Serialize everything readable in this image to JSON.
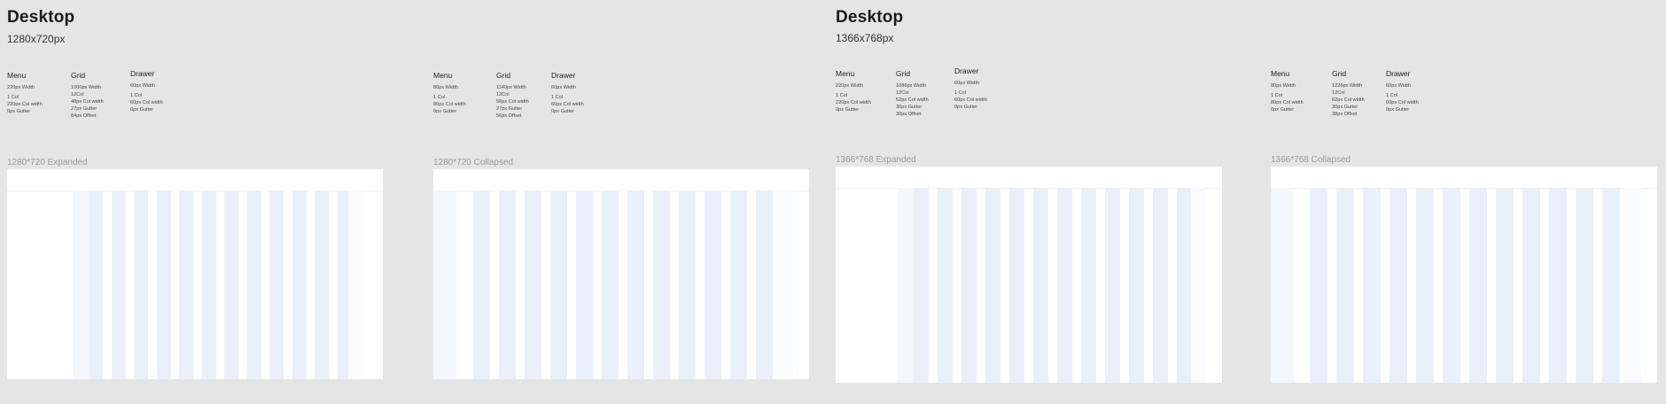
{
  "sections": [
    {
      "title": "Desktop",
      "subtitle": "1280x720px",
      "blocks": [
        {
          "columns": [
            {
              "heading": "Menu",
              "lines": [
                "220px Width",
                "",
                "1 Col",
                "220px Col width",
                "0px Gutter"
              ]
            },
            {
              "heading": "Grid",
              "lines": [
                "1000px Width",
                "12Col",
                "48px Col width",
                "27px Gutter",
                "84px Offset"
              ]
            },
            {
              "heading": "Drawer",
              "lines": [
                "60px Width",
                "",
                "1 Col",
                "60px Col width",
                "0px Gutter"
              ]
            }
          ]
        },
        {
          "columns": [
            {
              "heading": "Menu",
              "lines": [
                "80px Width",
                "",
                "1 Col",
                "80px Col width",
                "0px Gutter"
              ]
            },
            {
              "heading": "Grid",
              "lines": [
                "1140px Width",
                "12Col",
                "56px Col width",
                "27px Gutter",
                "56px Offset"
              ]
            },
            {
              "heading": "Drawer",
              "lines": [
                "60px Width",
                "",
                "1 Col",
                "60px Col width",
                "0px Gutter"
              ]
            }
          ]
        }
      ],
      "frames": [
        {
          "label": "1280*720 Expanded"
        },
        {
          "label": "1280*720 Collapsed"
        }
      ]
    },
    {
      "title": "Desktop",
      "subtitle": "1366x768px",
      "blocks": [
        {
          "columns": [
            {
              "heading": "Menu",
              "lines": [
                "220px Width",
                "",
                "1 Col",
                "220px Col width",
                "0px Gutter"
              ]
            },
            {
              "heading": "Grid",
              "lines": [
                "1086px Width",
                "12Col",
                "52px Col width",
                "30px Gutter",
                "30px Offset"
              ]
            },
            {
              "heading": "Drawer",
              "lines": [
                "60px Width",
                "",
                "1 Col",
                "60px Col width",
                "0px Gutter"
              ]
            }
          ]
        },
        {
          "columns": [
            {
              "heading": "Menu",
              "lines": [
                "80px Width",
                "",
                "1 Col",
                "80px Col width",
                "0px Gutter"
              ]
            },
            {
              "heading": "Grid",
              "lines": [
                "1226px Width",
                "12Col",
                "62px Col width",
                "30px Gutter",
                "38px Offset"
              ]
            },
            {
              "heading": "Drawer",
              "lines": [
                "60px Width",
                "",
                "1 Col",
                "60px Col width",
                "0px Gutter"
              ]
            }
          ]
        }
      ],
      "frames": [
        {
          "label": "1366*768 Expanded"
        },
        {
          "label": "1366*768 Collapsed"
        }
      ]
    }
  ]
}
